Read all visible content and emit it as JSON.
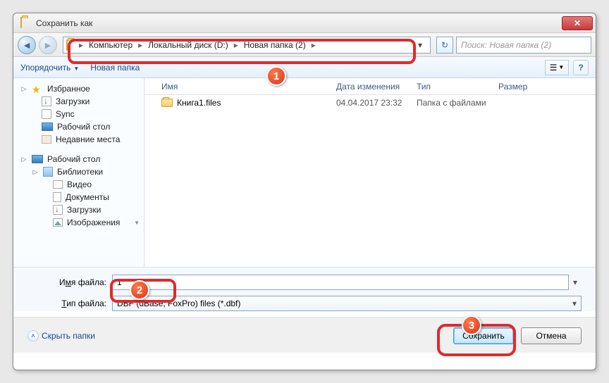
{
  "window": {
    "title": "Сохранить как"
  },
  "breadcrumb": {
    "parts": [
      "Компьютер",
      "Локальный диск (D:)",
      "Новая папка (2)"
    ],
    "sep": "▸"
  },
  "search": {
    "placeholder": "Поиск: Новая папка (2)"
  },
  "toolbar": {
    "organize": "Упорядочить",
    "new_folder": "Новая папка"
  },
  "sidebar": {
    "favorites": {
      "label": "Избранное",
      "items": [
        "Загрузки",
        "Sync",
        "Рабочий стол",
        "Недавние места"
      ]
    },
    "desktop": {
      "label": "Рабочий стол",
      "libs_label": "Библиотеки",
      "libs": [
        "Видео",
        "Документы",
        "Загрузки",
        "Изображения"
      ]
    }
  },
  "columns": {
    "name": "Имя",
    "date": "Дата изменения",
    "type": "Тип",
    "size": "Размер"
  },
  "rows": [
    {
      "name": "Книга1.files",
      "date": "04.04.2017 23:32",
      "type": "Папка с файлами"
    }
  ],
  "filename": {
    "label_pre": "И",
    "label_u": "м",
    "label_post": "я файла:",
    "value": "1"
  },
  "filetype": {
    "label_pre": "",
    "label_u": "Т",
    "label_post": "ип файла:",
    "value": "DBF (dBase, FoxPro) files (*.dbf)"
  },
  "hide_folders": "Скрыть папки",
  "buttons": {
    "save": "Сохранить",
    "cancel": "Отмена"
  },
  "annotations": {
    "1": "1",
    "2": "2",
    "3": "3"
  }
}
